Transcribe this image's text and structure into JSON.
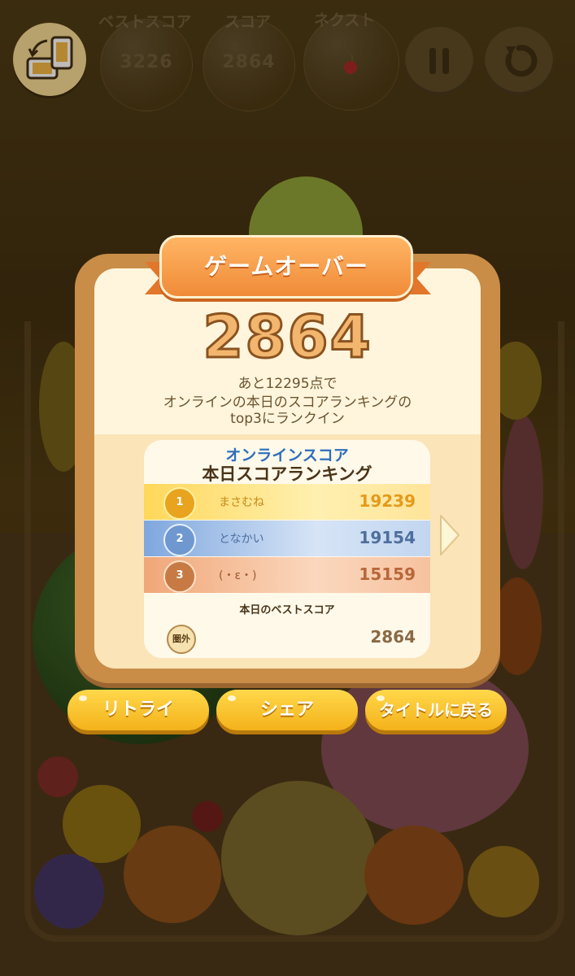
{
  "header": {
    "best_score_label": "ベストスコア",
    "best_score_value": "3226",
    "score_label": "スコア",
    "score_value": "2864",
    "next_label": "ネクスト",
    "next_fruit": "cherry-icon"
  },
  "dialog": {
    "title": "ゲームオーバー",
    "final_score": "2864",
    "info_line1": "あと12295点で",
    "info_line2": "オンラインの本日のスコアランキングの",
    "info_line3": "top3にランクイン"
  },
  "ranking": {
    "header_line1": "オンラインスコア",
    "header_line2": "本日スコアランキング",
    "entries": [
      {
        "rank": "1",
        "name": "まさむね",
        "score": "19239"
      },
      {
        "rank": "2",
        "name": "となかい",
        "score": "19154"
      },
      {
        "rank": "3",
        "name": "(・ε・)",
        "score": "15159"
      }
    ],
    "best_label": "本日のベストスコア",
    "best_rank": "圏外",
    "best_score": "2864"
  },
  "buttons": {
    "retry": "リトライ",
    "share": "シェア",
    "title": "タイトルに戻る"
  },
  "colors": {
    "gold": "#f2a623",
    "silver_blue": "#5276a8",
    "bronze": "#c96f3c",
    "button_yellow": "#f8c52c"
  }
}
